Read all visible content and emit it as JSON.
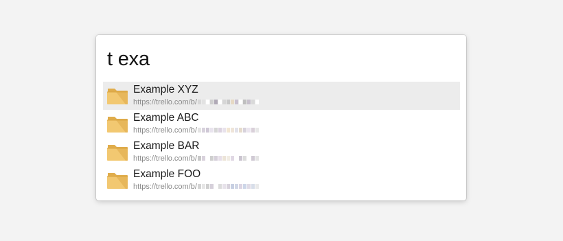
{
  "search": {
    "query": "t exa"
  },
  "results": [
    {
      "title": "Example XYZ",
      "url_prefix": "https://trello.com/b/",
      "icon": "folder-icon",
      "selected": true,
      "redacted_colors": [
        "#d8d8d8",
        "#e2e2e2",
        "#ffffff",
        "#cfcfcf",
        "#b0a9b6",
        "#ffffff",
        "#d6d6d6",
        "#c8c8c8",
        "#e6d9c4",
        "#c9c0cf",
        "#ffffff",
        "#bfbfbf",
        "#c7c0cc",
        "#d9d9d9",
        "#ffffff"
      ]
    },
    {
      "title": "Example ABC",
      "url_prefix": "https://trello.com/b/",
      "icon": "folder-icon",
      "selected": false,
      "redacted_colors": [
        "#e4e4e4",
        "#d8d2dc",
        "#cfc8d6",
        "#e9e4ee",
        "#d6d6d6",
        "#dcd3e0",
        "#e8e2ec",
        "#f2e6d3",
        "#efe5d9",
        "#e2e2ea",
        "#e6dbcc",
        "#d7d2dc",
        "#ece6f0",
        "#d9d0d9",
        "#e8e8e8"
      ]
    },
    {
      "title": "Example BAR",
      "url_prefix": "https://trello.com/b/",
      "icon": "folder-icon",
      "selected": false,
      "redacted_colors": [
        "#c8c8c8",
        "#d9d2dc",
        "#ffffff",
        "#cfcfcf",
        "#d6d0da",
        "#e7dfe9",
        "#ece4d8",
        "#f1ece3",
        "#e0d8e4",
        "#ffffff",
        "#cbc5d0",
        "#dcdcdc",
        "#ffffff",
        "#d0cad4",
        "#e4e4e4"
      ]
    },
    {
      "title": "Example FOO",
      "url_prefix": "https://trello.com/b/",
      "icon": "folder-icon",
      "selected": false,
      "redacted_colors": [
        "#d3d3d3",
        "#e6e6e6",
        "#cfcfcf",
        "#d6d0da",
        "#ffffff",
        "#dcdcdc",
        "#e7e2ea",
        "#d8d2dc",
        "#c7cfe2",
        "#d1d7e6",
        "#dcd5e3",
        "#cdd6e8",
        "#e0dbe6",
        "#d8dee9",
        "#eaeaea"
      ]
    }
  ],
  "colors": {
    "folder_fill": "#f2c871",
    "folder_tab": "#e0ad4c",
    "folder_shade": "#d9a441",
    "selection_bg": "#ececec"
  }
}
